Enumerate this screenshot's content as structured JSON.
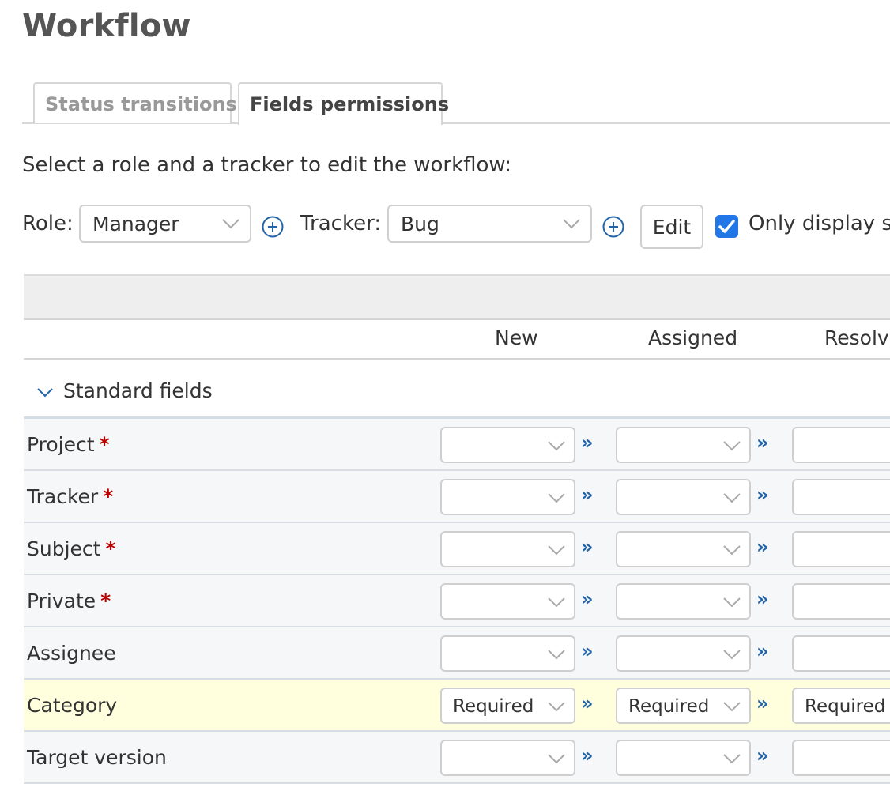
{
  "page": {
    "title": "Workflow"
  },
  "tabs": [
    {
      "label": "Status transitions",
      "active": false
    },
    {
      "label": "Fields permissions",
      "active": true
    }
  ],
  "instruction": "Select a role and a tracker to edit the workflow:",
  "filters": {
    "role_label": "Role:",
    "role_value": "Manager",
    "tracker_label": "Tracker:",
    "tracker_value": "Bug",
    "edit_button": "Edit",
    "only_display_label": "Only display s",
    "only_display_checked": true
  },
  "table": {
    "columns": [
      "New",
      "Assigned",
      "Resolve"
    ],
    "group_label": "Standard fields",
    "rows": [
      {
        "label": "Project",
        "required": true,
        "values": [
          "",
          "",
          ""
        ]
      },
      {
        "label": "Tracker",
        "required": true,
        "values": [
          "",
          "",
          ""
        ]
      },
      {
        "label": "Subject",
        "required": true,
        "values": [
          "",
          "",
          ""
        ]
      },
      {
        "label": "Private",
        "required": true,
        "values": [
          "",
          "",
          ""
        ]
      },
      {
        "label": "Assignee",
        "required": false,
        "values": [
          "",
          "",
          ""
        ]
      },
      {
        "label": "Category",
        "required": false,
        "values": [
          "Required",
          "Required",
          "Required"
        ],
        "highlighted": true
      },
      {
        "label": "Target version",
        "required": false,
        "values": [
          "",
          "",
          ""
        ]
      }
    ],
    "required_mark": "*",
    "copy_symbol": "»"
  },
  "colors": {
    "accent": "#2176e8",
    "link": "#2264a7",
    "required": "#bb0000",
    "highlight_row": "#ffffdd"
  }
}
